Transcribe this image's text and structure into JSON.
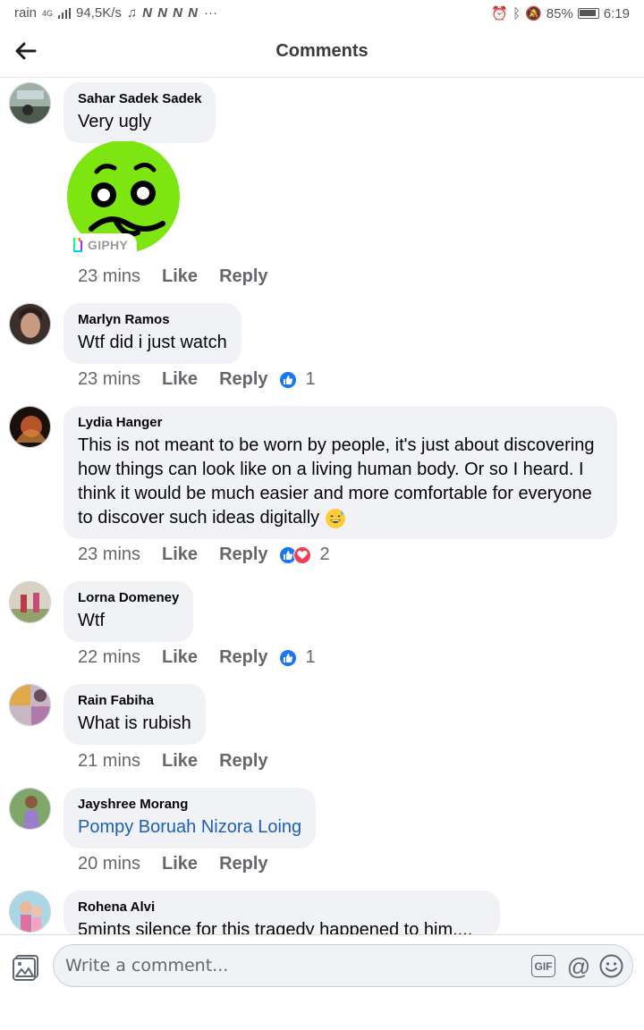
{
  "status_bar": {
    "carrier": "rain",
    "network": "4G",
    "speed": "94,5K/s",
    "battery": "85%",
    "time": "6:19"
  },
  "header": {
    "title": "Comments"
  },
  "comments": [
    {
      "author": "Sahar Sadek Sadek",
      "text": "Very ugly",
      "time": "23 mins",
      "like": "Like",
      "reply": "Reply",
      "gif_label": "GIPHY"
    },
    {
      "author": "Marlyn Ramos",
      "text": "Wtf did i just watch",
      "time": "23 mins",
      "like": "Like",
      "reply": "Reply",
      "reactions": "1"
    },
    {
      "author": "Lydia Hanger",
      "text_lines": [
        "This is not meant to be worn by people, it's just about discovering",
        "how things can look like on a living human body. Or so I heard. I",
        "think it would be much easier and more comfortable for everyone",
        "to discover such ideas digitally"
      ],
      "time": "23 mins",
      "like": "Like",
      "reply": "Reply",
      "reactions": "2"
    },
    {
      "author": "Lorna Domeney",
      "text": "Wtf",
      "time": "22 mins",
      "like": "Like",
      "reply": "Reply",
      "reactions": "1"
    },
    {
      "author": "Rain Fabiha",
      "text": "What is rubish",
      "time": "21 mins",
      "like": "Like",
      "reply": "Reply"
    },
    {
      "author": "Jayshree Morang",
      "text": "Pompy Boruah Nizora Loing",
      "time": "20 mins",
      "like": "Like",
      "reply": "Reply"
    },
    {
      "author": "Rohena Alvi",
      "text": "5mints silence for this tragedy happened to him...."
    }
  ],
  "composer": {
    "placeholder": "Write a comment...",
    "gif_label": "GIF"
  },
  "colors": {
    "bubble": "#f0f2f5",
    "mention": "#1e5fb5",
    "like_blue": "#1877f2",
    "love_red": "#f33e58",
    "emoji_green": "#7de50f"
  }
}
